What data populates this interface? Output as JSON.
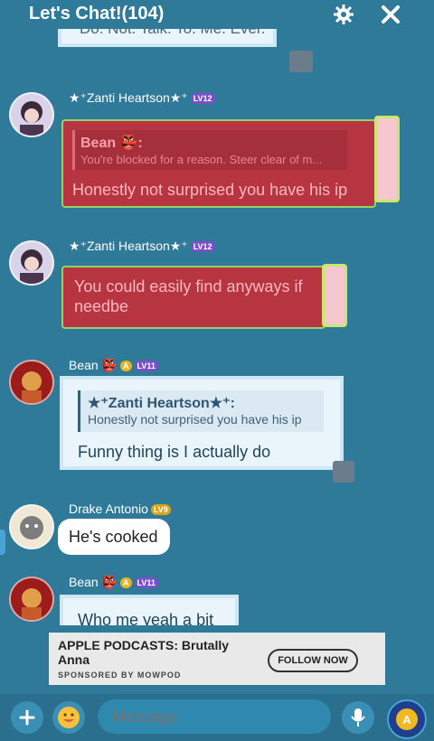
{
  "header": {
    "title": "Let's Chat!(104)",
    "settings_icon": "gear-icon",
    "close_icon": "close-icon"
  },
  "messages": [
    {
      "id": "m0",
      "text": "Do. Not. Talk. To. Me. Ever."
    },
    {
      "id": "m1",
      "author": "★⁺Zanti Heartson★⁺",
      "level": "LV12",
      "quote_author": "Bean 👺:",
      "quote_text": "You're blocked for a reason. Steer clear of m...",
      "text": "Honestly not surprised you have his ip"
    },
    {
      "id": "m2",
      "author": "★⁺Zanti Heartson★⁺",
      "level": "LV12",
      "text": "You could easily find anyways if needbe"
    },
    {
      "id": "m3",
      "author": "Bean 👺",
      "level": "LV11",
      "quote_author": "★⁺Zanti Heartson★⁺:",
      "quote_text": "Honestly not surprised you have his ip",
      "text": "Funny thing is I actually do"
    },
    {
      "id": "m4",
      "author": "Drake Antonio",
      "level": "LV9",
      "text": "He's cooked"
    },
    {
      "id": "m5",
      "author": "Bean 👺",
      "level": "LV11",
      "text": "Who me yeah a bit"
    }
  ],
  "ad": {
    "title_line1": "APPLE PODCASTS: Brutally",
    "title_line2": "Anna",
    "sponsor": "SPONSORED BY MOWPOD",
    "button": "FOLLOW NOW"
  },
  "composer": {
    "placeholder": "Message",
    "add_icon": "plus-icon",
    "sticker_icon": "smiley-icon",
    "mic_icon": "microphone-icon",
    "coin_icon": "coin-icon"
  },
  "colors": {
    "background": "#2f7a99",
    "red_bubble": "#b73441",
    "blue_bubble": "#eaf4fb"
  }
}
